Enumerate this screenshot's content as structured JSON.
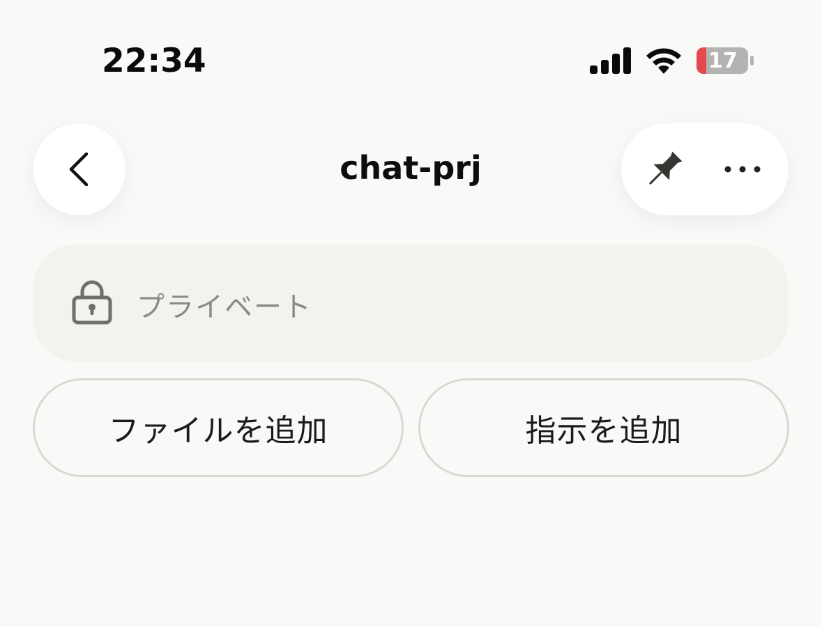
{
  "status_bar": {
    "time": "22:34",
    "battery_level": "17",
    "battery_low_color": "#e5484d",
    "battery_fill_fraction": 0.17
  },
  "header": {
    "back_icon": "chevron-left-icon",
    "title": "chat-prj",
    "pin_icon": "pin-icon",
    "more_icon": "ellipsis-icon"
  },
  "privacy": {
    "icon": "lock-icon",
    "label": "プライベート"
  },
  "actions": {
    "add_file_label": "ファイルを追加",
    "add_instruction_label": "指示を追加"
  }
}
